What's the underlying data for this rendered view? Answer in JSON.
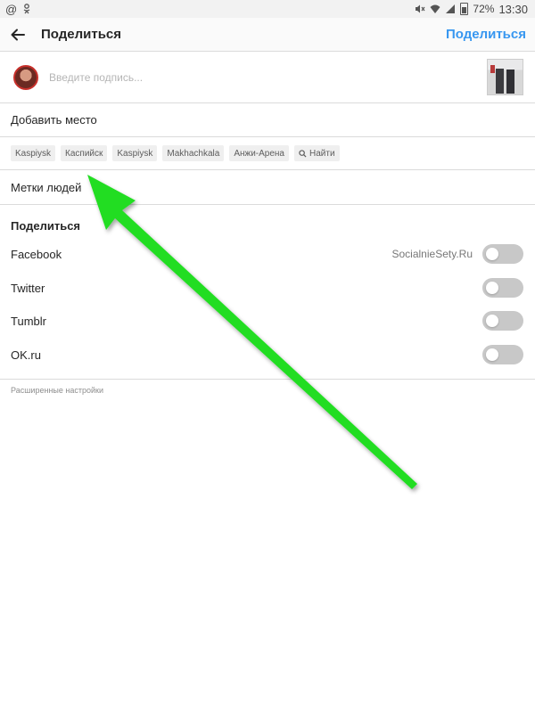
{
  "status_bar": {
    "left_icons": [
      "at-sign-icon",
      "odnoklassniki-icon"
    ],
    "battery": "72%",
    "time": "13:30"
  },
  "header": {
    "title": "Поделиться",
    "action_label": "Поделиться",
    "accent_color": "#3897f0"
  },
  "caption": {
    "placeholder": "Введите подпись..."
  },
  "place": {
    "label": "Добавить место",
    "suggestions": [
      "Kaspiysk",
      "Каспийск",
      "Kaspiysk",
      "Makhachkala",
      "Анжи-Арена"
    ],
    "search_label": "Найти"
  },
  "tags": {
    "label": "Метки людей"
  },
  "share": {
    "heading": "Поделиться",
    "items": [
      {
        "label": "Facebook",
        "account": "SocialnieSety.Ru",
        "enabled": false
      },
      {
        "label": "Twitter",
        "account": "",
        "enabled": false
      },
      {
        "label": "Tumblr",
        "account": "",
        "enabled": false
      },
      {
        "label": "OK.ru",
        "account": "",
        "enabled": false
      }
    ]
  },
  "advanced_label": "Расширенные настройки",
  "overlay": {
    "arrow_color": "#22dd22"
  }
}
